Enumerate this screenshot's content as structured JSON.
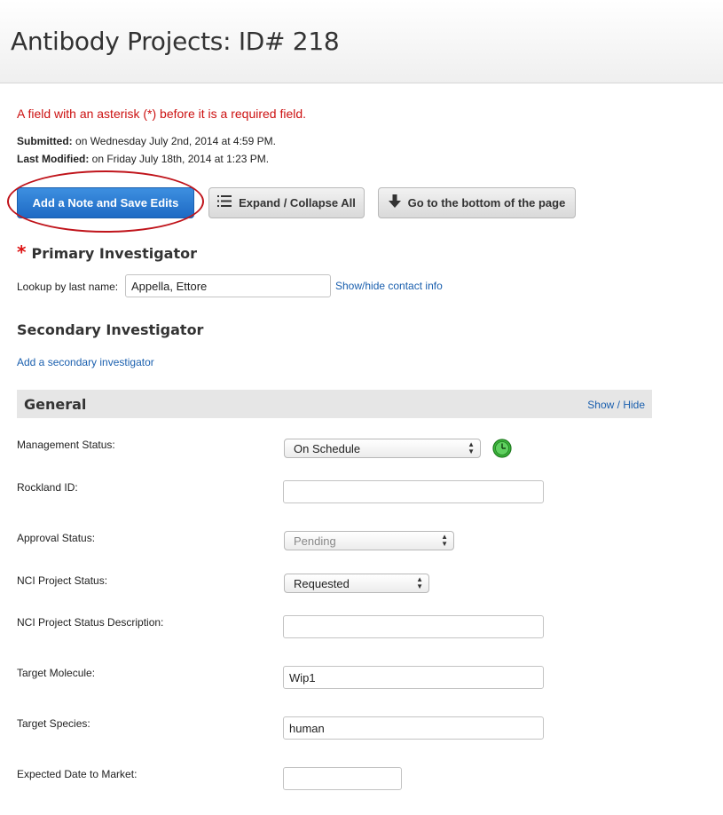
{
  "header": {
    "title": "Antibody Projects: ID# 218"
  },
  "required_note": "A field with an asterisk (*) before it is a required field.",
  "meta": {
    "submitted_label": "Submitted:",
    "submitted_value": "on Wednesday July 2nd, 2014 at 4:59 PM.",
    "modified_label": "Last Modified:",
    "modified_value": "on Friday July 18th, 2014 at 1:23 PM."
  },
  "toolbar": {
    "save_label": "Add a Note and Save Edits",
    "expand_label": "Expand / Collapse All",
    "bottom_label": "Go to the bottom of the page",
    "expand_icon": "list-icon",
    "bottom_icon": "arrow-down-icon"
  },
  "primary": {
    "asterisk": "*",
    "heading": "Primary Investigator",
    "lookup_label": "Lookup by last name:",
    "lookup_value": "Appella, Ettore",
    "contact_link": "Show/hide contact info"
  },
  "secondary": {
    "heading": "Secondary Investigator",
    "add_link": "Add a secondary investigator"
  },
  "general": {
    "heading": "General",
    "toggle_link": "Show / Hide",
    "fields": {
      "management_status": {
        "label": "Management Status:",
        "value": "On Schedule"
      },
      "rockland_id": {
        "label": "Rockland ID:",
        "value": ""
      },
      "approval_status": {
        "label": "Approval Status:",
        "value": "Pending"
      },
      "nci_project_status": {
        "label": "NCI Project Status:",
        "value": "Requested"
      },
      "nci_status_description": {
        "label": "NCI Project Status Description:",
        "value": ""
      },
      "target_molecule": {
        "label": "Target Molecule:",
        "value": "Wip1"
      },
      "target_species": {
        "label": "Target Species:",
        "value": "human"
      },
      "expected_date": {
        "label": "Expected Date to Market:",
        "value": ""
      }
    }
  },
  "colors": {
    "primary_button": "#1e6ac4",
    "required_text": "#cc1111",
    "link": "#1a5fae",
    "status_clock": "#3cb83c"
  }
}
